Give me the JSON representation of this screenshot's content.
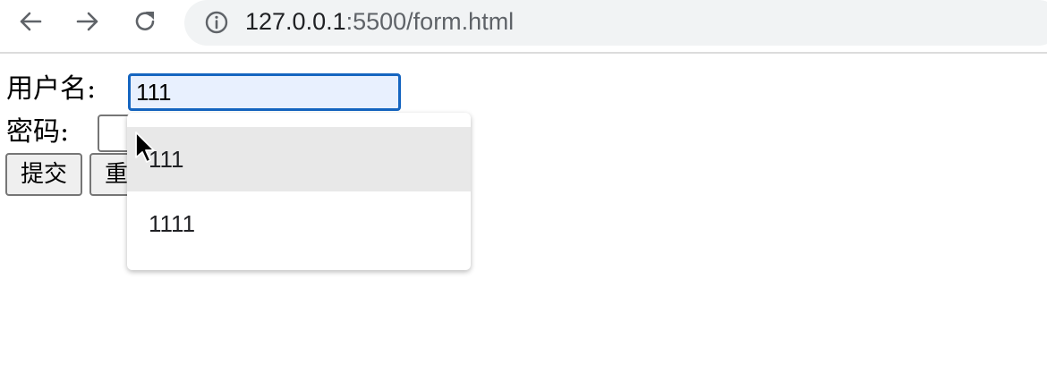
{
  "browser": {
    "url_host": "127.0.0.1",
    "url_rest": ":5500/form.html",
    "back_icon": "arrow-left-icon",
    "forward_icon": "arrow-right-icon",
    "reload_icon": "reload-icon",
    "info_icon": "info-circle-icon"
  },
  "form": {
    "username_label": "用户名:",
    "username_value": "111",
    "password_label": "密码:",
    "password_value": "",
    "submit_label": "提交",
    "reset_label": "重置"
  },
  "autocomplete": {
    "items": [
      "111",
      "1111"
    ],
    "highlighted_index": 0
  },
  "colors": {
    "focus_border": "#1565c0",
    "autofill_bg": "#e8f0fe",
    "omnibox_bg": "#f1f3f4",
    "highlight_bg": "#e8e8e8"
  }
}
